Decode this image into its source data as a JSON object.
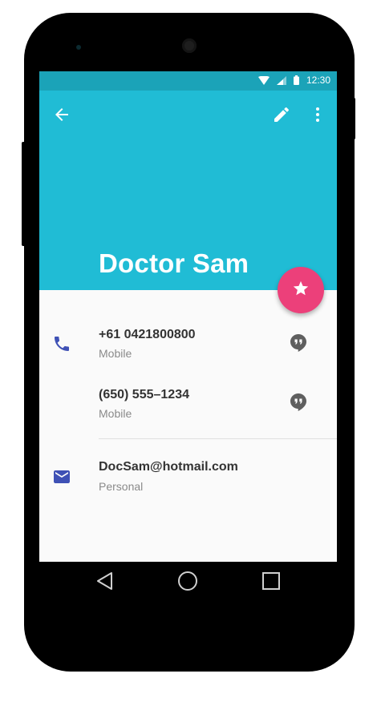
{
  "status_bar": {
    "time": "12:30"
  },
  "contact": {
    "name": "Doctor Sam",
    "phones": [
      {
        "number": "+61 0421800800",
        "type": "Mobile"
      },
      {
        "number": "(650) 555–1234",
        "type": "Mobile"
      }
    ],
    "email": {
      "address": "DocSam@hotmail.com",
      "type": "Personal"
    }
  },
  "colors": {
    "header": "#20bcd5",
    "status_bar": "#1ba3b8",
    "fab": "#ec407a",
    "icon_accent": "#3f51b5"
  },
  "icons": {
    "toolbar": [
      "back-arrow-icon",
      "edit-pencil-icon",
      "more-vert-icon"
    ],
    "fab": "star-icon",
    "rows": [
      "phone-icon",
      "hangouts-icon",
      "email-icon"
    ],
    "nav": [
      "back-triangle-icon",
      "home-circle-icon",
      "recents-square-icon"
    ]
  }
}
